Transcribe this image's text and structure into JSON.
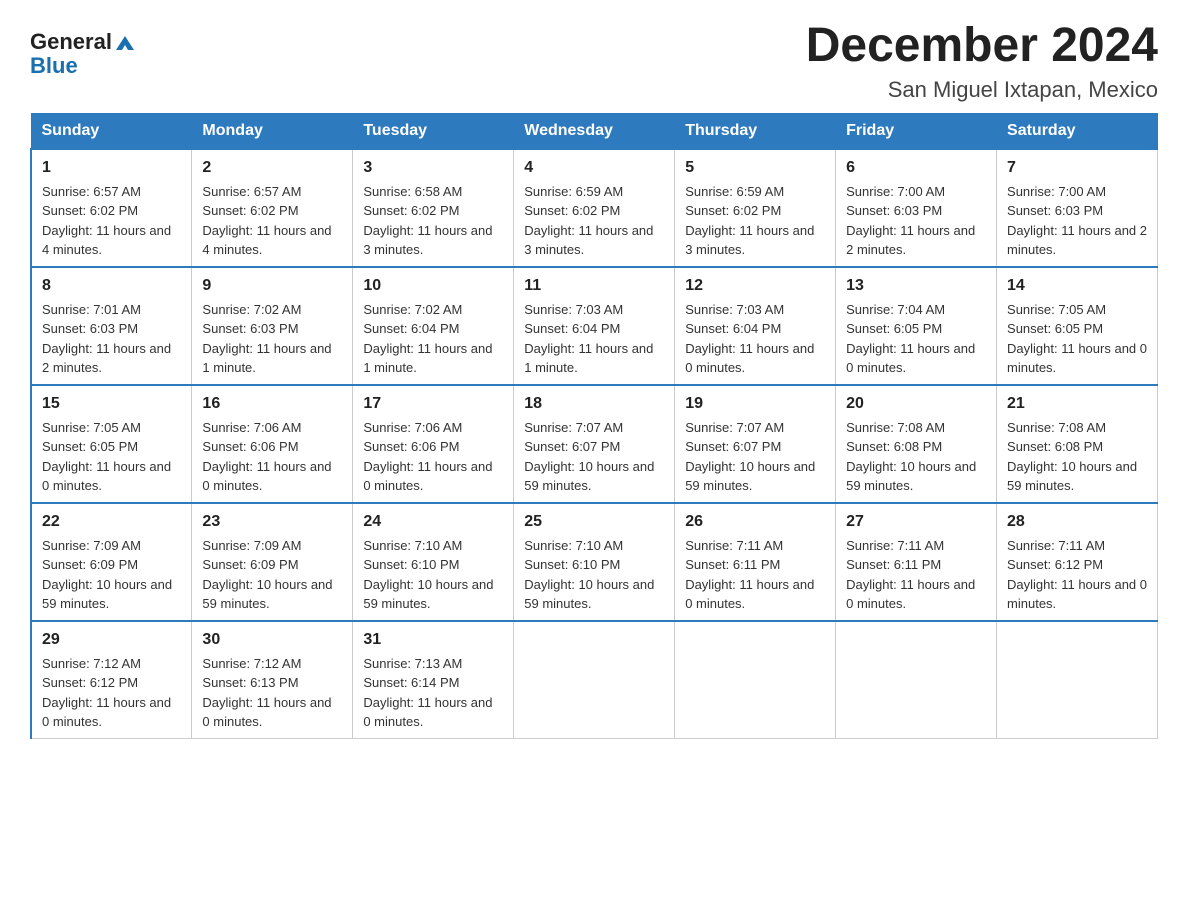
{
  "logo": {
    "general": "General",
    "blue": "Blue",
    "tagline": ""
  },
  "title": "December 2024",
  "subtitle": "San Miguel Ixtapan, Mexico",
  "days_of_week": [
    "Sunday",
    "Monday",
    "Tuesday",
    "Wednesday",
    "Thursday",
    "Friday",
    "Saturday"
  ],
  "weeks": [
    [
      {
        "day": "1",
        "sunrise": "6:57 AM",
        "sunset": "6:02 PM",
        "daylight": "11 hours and 4 minutes."
      },
      {
        "day": "2",
        "sunrise": "6:57 AM",
        "sunset": "6:02 PM",
        "daylight": "11 hours and 4 minutes."
      },
      {
        "day": "3",
        "sunrise": "6:58 AM",
        "sunset": "6:02 PM",
        "daylight": "11 hours and 3 minutes."
      },
      {
        "day": "4",
        "sunrise": "6:59 AM",
        "sunset": "6:02 PM",
        "daylight": "11 hours and 3 minutes."
      },
      {
        "day": "5",
        "sunrise": "6:59 AM",
        "sunset": "6:02 PM",
        "daylight": "11 hours and 3 minutes."
      },
      {
        "day": "6",
        "sunrise": "7:00 AM",
        "sunset": "6:03 PM",
        "daylight": "11 hours and 2 minutes."
      },
      {
        "day": "7",
        "sunrise": "7:00 AM",
        "sunset": "6:03 PM",
        "daylight": "11 hours and 2 minutes."
      }
    ],
    [
      {
        "day": "8",
        "sunrise": "7:01 AM",
        "sunset": "6:03 PM",
        "daylight": "11 hours and 2 minutes."
      },
      {
        "day": "9",
        "sunrise": "7:02 AM",
        "sunset": "6:03 PM",
        "daylight": "11 hours and 1 minute."
      },
      {
        "day": "10",
        "sunrise": "7:02 AM",
        "sunset": "6:04 PM",
        "daylight": "11 hours and 1 minute."
      },
      {
        "day": "11",
        "sunrise": "7:03 AM",
        "sunset": "6:04 PM",
        "daylight": "11 hours and 1 minute."
      },
      {
        "day": "12",
        "sunrise": "7:03 AM",
        "sunset": "6:04 PM",
        "daylight": "11 hours and 0 minutes."
      },
      {
        "day": "13",
        "sunrise": "7:04 AM",
        "sunset": "6:05 PM",
        "daylight": "11 hours and 0 minutes."
      },
      {
        "day": "14",
        "sunrise": "7:05 AM",
        "sunset": "6:05 PM",
        "daylight": "11 hours and 0 minutes."
      }
    ],
    [
      {
        "day": "15",
        "sunrise": "7:05 AM",
        "sunset": "6:05 PM",
        "daylight": "11 hours and 0 minutes."
      },
      {
        "day": "16",
        "sunrise": "7:06 AM",
        "sunset": "6:06 PM",
        "daylight": "11 hours and 0 minutes."
      },
      {
        "day": "17",
        "sunrise": "7:06 AM",
        "sunset": "6:06 PM",
        "daylight": "11 hours and 0 minutes."
      },
      {
        "day": "18",
        "sunrise": "7:07 AM",
        "sunset": "6:07 PM",
        "daylight": "10 hours and 59 minutes."
      },
      {
        "day": "19",
        "sunrise": "7:07 AM",
        "sunset": "6:07 PM",
        "daylight": "10 hours and 59 minutes."
      },
      {
        "day": "20",
        "sunrise": "7:08 AM",
        "sunset": "6:08 PM",
        "daylight": "10 hours and 59 minutes."
      },
      {
        "day": "21",
        "sunrise": "7:08 AM",
        "sunset": "6:08 PM",
        "daylight": "10 hours and 59 minutes."
      }
    ],
    [
      {
        "day": "22",
        "sunrise": "7:09 AM",
        "sunset": "6:09 PM",
        "daylight": "10 hours and 59 minutes."
      },
      {
        "day": "23",
        "sunrise": "7:09 AM",
        "sunset": "6:09 PM",
        "daylight": "10 hours and 59 minutes."
      },
      {
        "day": "24",
        "sunrise": "7:10 AM",
        "sunset": "6:10 PM",
        "daylight": "10 hours and 59 minutes."
      },
      {
        "day": "25",
        "sunrise": "7:10 AM",
        "sunset": "6:10 PM",
        "daylight": "10 hours and 59 minutes."
      },
      {
        "day": "26",
        "sunrise": "7:11 AM",
        "sunset": "6:11 PM",
        "daylight": "11 hours and 0 minutes."
      },
      {
        "day": "27",
        "sunrise": "7:11 AM",
        "sunset": "6:11 PM",
        "daylight": "11 hours and 0 minutes."
      },
      {
        "day": "28",
        "sunrise": "7:11 AM",
        "sunset": "6:12 PM",
        "daylight": "11 hours and 0 minutes."
      }
    ],
    [
      {
        "day": "29",
        "sunrise": "7:12 AM",
        "sunset": "6:12 PM",
        "daylight": "11 hours and 0 minutes."
      },
      {
        "day": "30",
        "sunrise": "7:12 AM",
        "sunset": "6:13 PM",
        "daylight": "11 hours and 0 minutes."
      },
      {
        "day": "31",
        "sunrise": "7:13 AM",
        "sunset": "6:14 PM",
        "daylight": "11 hours and 0 minutes."
      },
      null,
      null,
      null,
      null
    ]
  ],
  "labels": {
    "sunrise": "Sunrise:",
    "sunset": "Sunset:",
    "daylight": "Daylight:"
  }
}
